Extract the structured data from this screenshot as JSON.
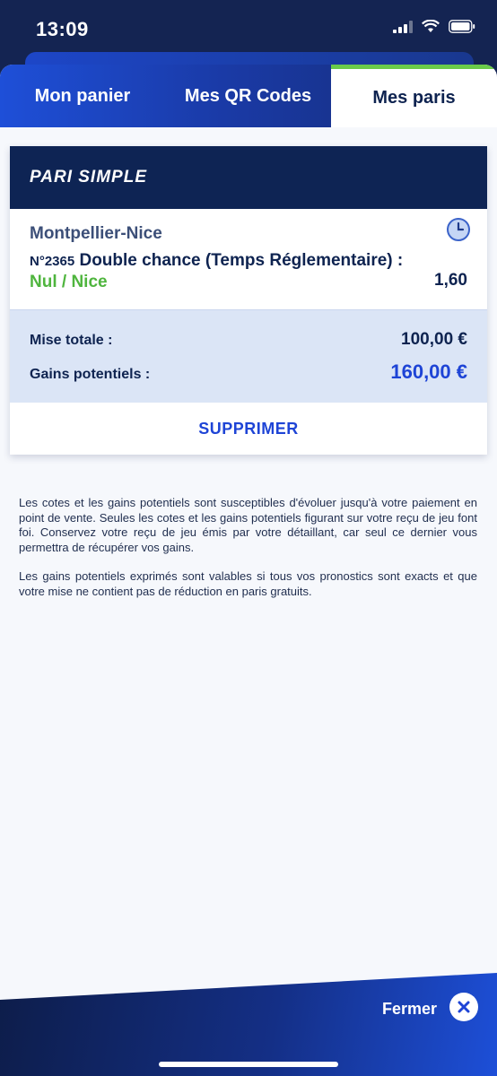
{
  "status_bar": {
    "time": "13:09"
  },
  "tabs": [
    {
      "label": "Mon panier"
    },
    {
      "label": "Mes QR Codes"
    },
    {
      "label": "Mes paris"
    }
  ],
  "bet_card": {
    "header": "PARI SIMPLE",
    "match": "Montpellier-Nice",
    "bet_number": "N°2365",
    "bet_type": "Double chance (Temps Réglementaire) :",
    "bet_choice": "Nul / Nice",
    "odds": "1,60",
    "stake_label": "Mise totale :",
    "stake_value": "100,00 €",
    "gains_label": "Gains potentiels :",
    "gains_value": "160,00 €",
    "delete_label": "SUPPRIMER"
  },
  "disclaimer": {
    "p1": "Les cotes et les gains potentiels sont susceptibles d'évoluer jusqu'à votre paiement en point de vente. Seules les cotes et les gains potentiels figurant sur votre reçu de jeu font foi. Conservez votre reçu de jeu émis par votre détaillant, car seul ce dernier vous permettra de récupérer vos gains.",
    "p2": "Les gains potentiels exprimés sont valables si tous vos pronostics sont exacts et que votre mise ne contient pas de réduction en paris gratuits."
  },
  "footer": {
    "close_label": "Fermer"
  },
  "colors": {
    "navy": "#0e2454",
    "accent_blue": "#1e44d6",
    "green": "#4fb53e",
    "active_tab_bar": "#6acb4a"
  }
}
